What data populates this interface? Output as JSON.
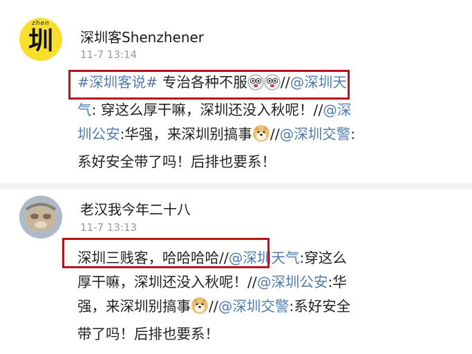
{
  "posts": [
    {
      "username": "深圳客Shenzhener",
      "time": "11-7 13:14",
      "avatar_caption": "zhen",
      "avatar_char": "圳",
      "lines": [
        [
          "#深圳客说#",
          " 专治各种不服",
          "",
          "",
          "//",
          "@深圳天"
        ],
        [
          "气",
          ": 穿这么厚干嘛，深圳还没入秋呢！//",
          "@深"
        ],
        [
          "圳公安",
          ":华强，来深圳别搞事",
          "",
          "//",
          "@深圳交警",
          ":"
        ],
        [
          "系好安全带了吗！后排也要系！"
        ]
      ]
    },
    {
      "username": "老汉我今年二十八",
      "time": "11-7 13:13",
      "lines": [
        [
          "深圳三贱客，哈哈哈哈//",
          "@深圳天气",
          ":穿这么"
        ],
        [
          "厚干嘛，深圳还没入秋呢！//",
          "@深圳公安",
          ":华"
        ],
        [
          "强，来深圳别搞事",
          "",
          "//",
          "@深圳交警",
          ":系好安全"
        ],
        [
          "带了吗！后排也要系！"
        ]
      ]
    }
  ]
}
